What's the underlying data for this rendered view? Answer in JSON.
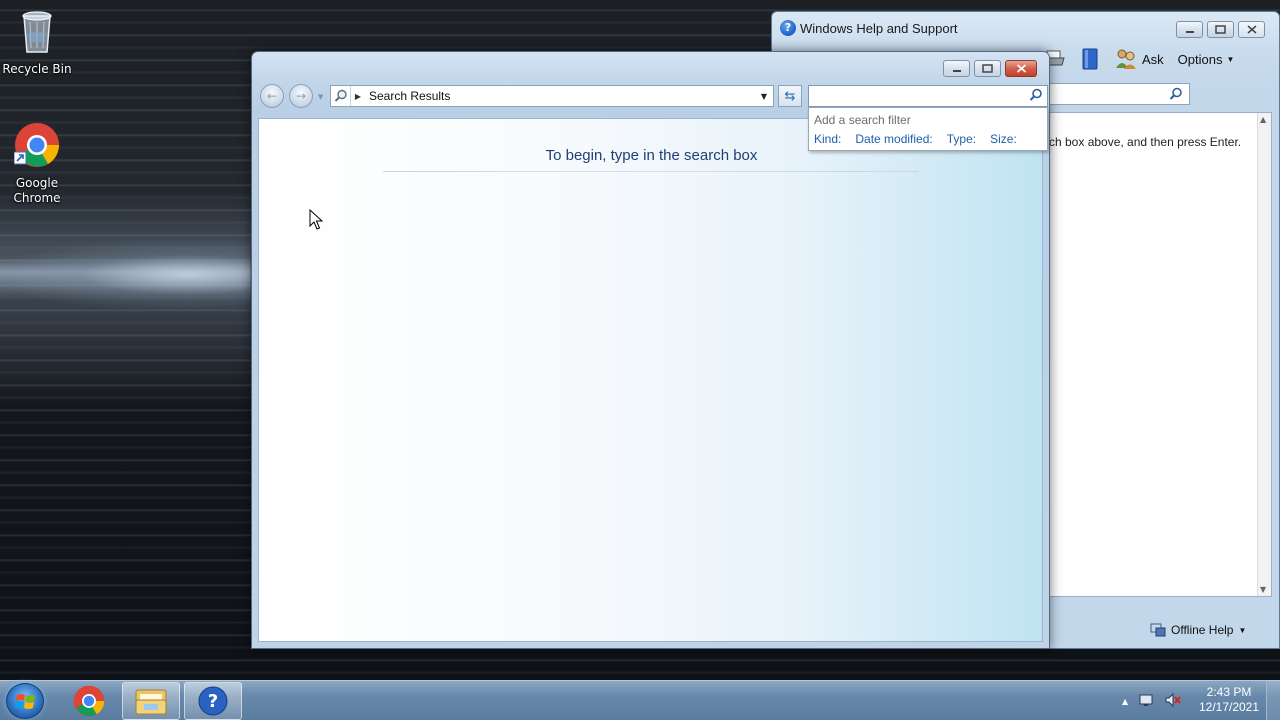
{
  "desktop": {
    "icons": [
      {
        "label": "Recycle Bin"
      },
      {
        "label": "Google Chrome"
      }
    ]
  },
  "help_window": {
    "title": "Windows Help and Support",
    "toolbar": {
      "ask_label": "Ask",
      "options_label": "Options"
    },
    "content_text": "ch box above, and then press Enter.",
    "status": {
      "offline_help_label": "Offline Help"
    }
  },
  "search_window": {
    "address": {
      "text": "Search Results"
    },
    "search": {
      "value": "",
      "placeholder": ""
    },
    "filter": {
      "title": "Add a search filter",
      "options": [
        "Kind:",
        "Date modified:",
        "Type:",
        "Size:"
      ]
    },
    "results_message": "To begin, type in the search box"
  },
  "taskbar": {
    "clock": {
      "time": "2:43 PM",
      "date": "12/17/2021"
    }
  },
  "colors": {
    "accent_link": "#1e5fa8",
    "results_text": "#1f3f73",
    "close_button": "#c2412a"
  }
}
